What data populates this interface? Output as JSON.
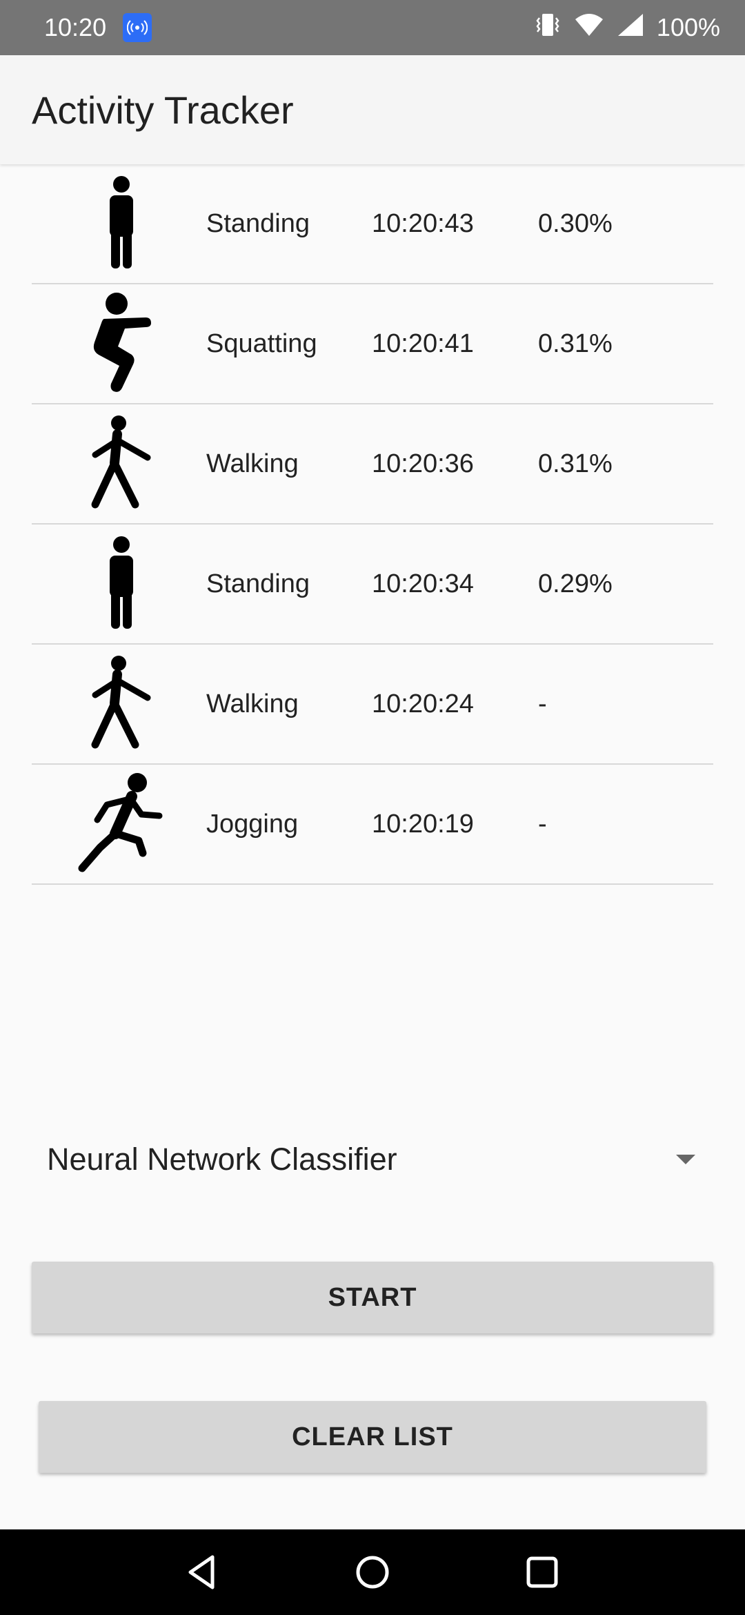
{
  "status_bar": {
    "time": "10:20",
    "battery": "100%",
    "icons": [
      "cast-icon",
      "vibrate-icon",
      "wifi-icon",
      "signal-icon"
    ]
  },
  "app": {
    "title": "Activity Tracker"
  },
  "activities": [
    {
      "icon": "standing-icon",
      "name": "Standing",
      "time": "10:20:43",
      "value": "0.30%"
    },
    {
      "icon": "squatting-icon",
      "name": "Squatting",
      "time": "10:20:41",
      "value": "0.31%"
    },
    {
      "icon": "walking-icon",
      "name": "Walking",
      "time": "10:20:36",
      "value": "0.31%"
    },
    {
      "icon": "standing-icon",
      "name": "Standing",
      "time": "10:20:34",
      "value": "0.29%"
    },
    {
      "icon": "walking-icon",
      "name": "Walking",
      "time": "10:20:24",
      "value": "-"
    },
    {
      "icon": "jogging-icon",
      "name": "Jogging",
      "time": "10:20:19",
      "value": "-"
    }
  ],
  "classifier": {
    "selected": "Neural Network Classifier"
  },
  "buttons": {
    "start": "START",
    "clear": "CLEAR LIST"
  },
  "nav": {
    "icons": [
      "back-icon",
      "home-icon",
      "recents-icon"
    ]
  },
  "colors": {
    "status_bar_bg": "#757575",
    "cast_badge": "#2d6df6",
    "button_bg": "#d6d6d6",
    "nav_bg": "#000000"
  }
}
